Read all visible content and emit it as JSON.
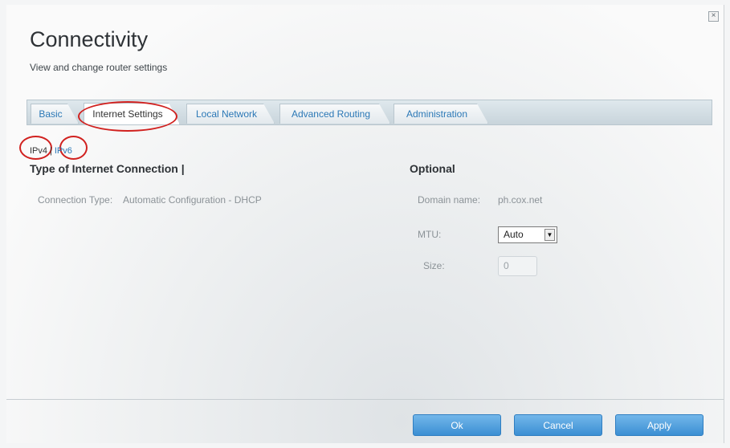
{
  "header": {
    "title": "Connectivity",
    "subtitle": "View and change router settings",
    "close_icon": "close-icon"
  },
  "tabs": [
    {
      "label": "Basic",
      "active": false
    },
    {
      "label": "Internet Settings",
      "active": true
    },
    {
      "label": "Local Network",
      "active": false
    },
    {
      "label": "Advanced Routing",
      "active": false
    },
    {
      "label": "Administration",
      "active": false
    }
  ],
  "ip_toggle": {
    "ipv4": "IPv4",
    "separator": "|",
    "ipv6": "IPv6"
  },
  "connection": {
    "heading": "Type of Internet Connection |",
    "type_label": "Connection Type:",
    "type_value": "Automatic Configuration - DHCP"
  },
  "optional": {
    "heading": "Optional",
    "domain_label": "Domain name:",
    "domain_value": "ph.cox.net",
    "mtu_label": "MTU:",
    "mtu_value": "Auto",
    "size_label": "Size:",
    "size_value": "0"
  },
  "footer": {
    "ok_label": "Ok",
    "cancel_label": "Cancel",
    "apply_label": "Apply"
  },
  "colors": {
    "accent": "#2b78b6",
    "button": "#4a9bdb",
    "annotation": "#d1211f"
  }
}
